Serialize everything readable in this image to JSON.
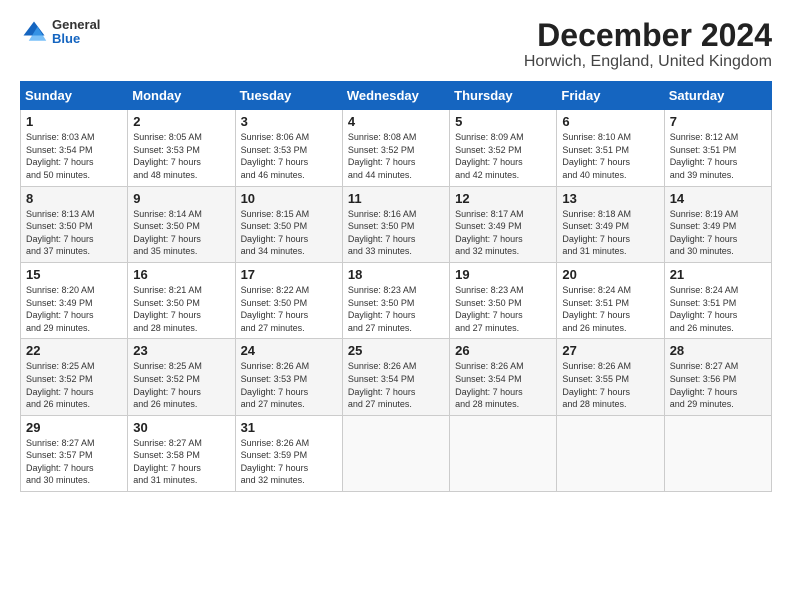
{
  "header": {
    "logo": {
      "general": "General",
      "blue": "Blue"
    },
    "title": "December 2024",
    "subtitle": "Horwich, England, United Kingdom"
  },
  "weekdays": [
    "Sunday",
    "Monday",
    "Tuesday",
    "Wednesday",
    "Thursday",
    "Friday",
    "Saturday"
  ],
  "weeks": [
    [
      {
        "day": "1",
        "info": "Sunrise: 8:03 AM\nSunset: 3:54 PM\nDaylight: 7 hours\nand 50 minutes."
      },
      {
        "day": "2",
        "info": "Sunrise: 8:05 AM\nSunset: 3:53 PM\nDaylight: 7 hours\nand 48 minutes."
      },
      {
        "day": "3",
        "info": "Sunrise: 8:06 AM\nSunset: 3:53 PM\nDaylight: 7 hours\nand 46 minutes."
      },
      {
        "day": "4",
        "info": "Sunrise: 8:08 AM\nSunset: 3:52 PM\nDaylight: 7 hours\nand 44 minutes."
      },
      {
        "day": "5",
        "info": "Sunrise: 8:09 AM\nSunset: 3:52 PM\nDaylight: 7 hours\nand 42 minutes."
      },
      {
        "day": "6",
        "info": "Sunrise: 8:10 AM\nSunset: 3:51 PM\nDaylight: 7 hours\nand 40 minutes."
      },
      {
        "day": "7",
        "info": "Sunrise: 8:12 AM\nSunset: 3:51 PM\nDaylight: 7 hours\nand 39 minutes."
      }
    ],
    [
      {
        "day": "8",
        "info": "Sunrise: 8:13 AM\nSunset: 3:50 PM\nDaylight: 7 hours\nand 37 minutes."
      },
      {
        "day": "9",
        "info": "Sunrise: 8:14 AM\nSunset: 3:50 PM\nDaylight: 7 hours\nand 35 minutes."
      },
      {
        "day": "10",
        "info": "Sunrise: 8:15 AM\nSunset: 3:50 PM\nDaylight: 7 hours\nand 34 minutes."
      },
      {
        "day": "11",
        "info": "Sunrise: 8:16 AM\nSunset: 3:50 PM\nDaylight: 7 hours\nand 33 minutes."
      },
      {
        "day": "12",
        "info": "Sunrise: 8:17 AM\nSunset: 3:49 PM\nDaylight: 7 hours\nand 32 minutes."
      },
      {
        "day": "13",
        "info": "Sunrise: 8:18 AM\nSunset: 3:49 PM\nDaylight: 7 hours\nand 31 minutes."
      },
      {
        "day": "14",
        "info": "Sunrise: 8:19 AM\nSunset: 3:49 PM\nDaylight: 7 hours\nand 30 minutes."
      }
    ],
    [
      {
        "day": "15",
        "info": "Sunrise: 8:20 AM\nSunset: 3:49 PM\nDaylight: 7 hours\nand 29 minutes."
      },
      {
        "day": "16",
        "info": "Sunrise: 8:21 AM\nSunset: 3:50 PM\nDaylight: 7 hours\nand 28 minutes."
      },
      {
        "day": "17",
        "info": "Sunrise: 8:22 AM\nSunset: 3:50 PM\nDaylight: 7 hours\nand 27 minutes."
      },
      {
        "day": "18",
        "info": "Sunrise: 8:23 AM\nSunset: 3:50 PM\nDaylight: 7 hours\nand 27 minutes."
      },
      {
        "day": "19",
        "info": "Sunrise: 8:23 AM\nSunset: 3:50 PM\nDaylight: 7 hours\nand 27 minutes."
      },
      {
        "day": "20",
        "info": "Sunrise: 8:24 AM\nSunset: 3:51 PM\nDaylight: 7 hours\nand 26 minutes."
      },
      {
        "day": "21",
        "info": "Sunrise: 8:24 AM\nSunset: 3:51 PM\nDaylight: 7 hours\nand 26 minutes."
      }
    ],
    [
      {
        "day": "22",
        "info": "Sunrise: 8:25 AM\nSunset: 3:52 PM\nDaylight: 7 hours\nand 26 minutes."
      },
      {
        "day": "23",
        "info": "Sunrise: 8:25 AM\nSunset: 3:52 PM\nDaylight: 7 hours\nand 26 minutes."
      },
      {
        "day": "24",
        "info": "Sunrise: 8:26 AM\nSunset: 3:53 PM\nDaylight: 7 hours\nand 27 minutes."
      },
      {
        "day": "25",
        "info": "Sunrise: 8:26 AM\nSunset: 3:54 PM\nDaylight: 7 hours\nand 27 minutes."
      },
      {
        "day": "26",
        "info": "Sunrise: 8:26 AM\nSunset: 3:54 PM\nDaylight: 7 hours\nand 28 minutes."
      },
      {
        "day": "27",
        "info": "Sunrise: 8:26 AM\nSunset: 3:55 PM\nDaylight: 7 hours\nand 28 minutes."
      },
      {
        "day": "28",
        "info": "Sunrise: 8:27 AM\nSunset: 3:56 PM\nDaylight: 7 hours\nand 29 minutes."
      }
    ],
    [
      {
        "day": "29",
        "info": "Sunrise: 8:27 AM\nSunset: 3:57 PM\nDaylight: 7 hours\nand 30 minutes."
      },
      {
        "day": "30",
        "info": "Sunrise: 8:27 AM\nSunset: 3:58 PM\nDaylight: 7 hours\nand 31 minutes."
      },
      {
        "day": "31",
        "info": "Sunrise: 8:26 AM\nSunset: 3:59 PM\nDaylight: 7 hours\nand 32 minutes."
      },
      {
        "day": "",
        "info": ""
      },
      {
        "day": "",
        "info": ""
      },
      {
        "day": "",
        "info": ""
      },
      {
        "day": "",
        "info": ""
      }
    ]
  ]
}
